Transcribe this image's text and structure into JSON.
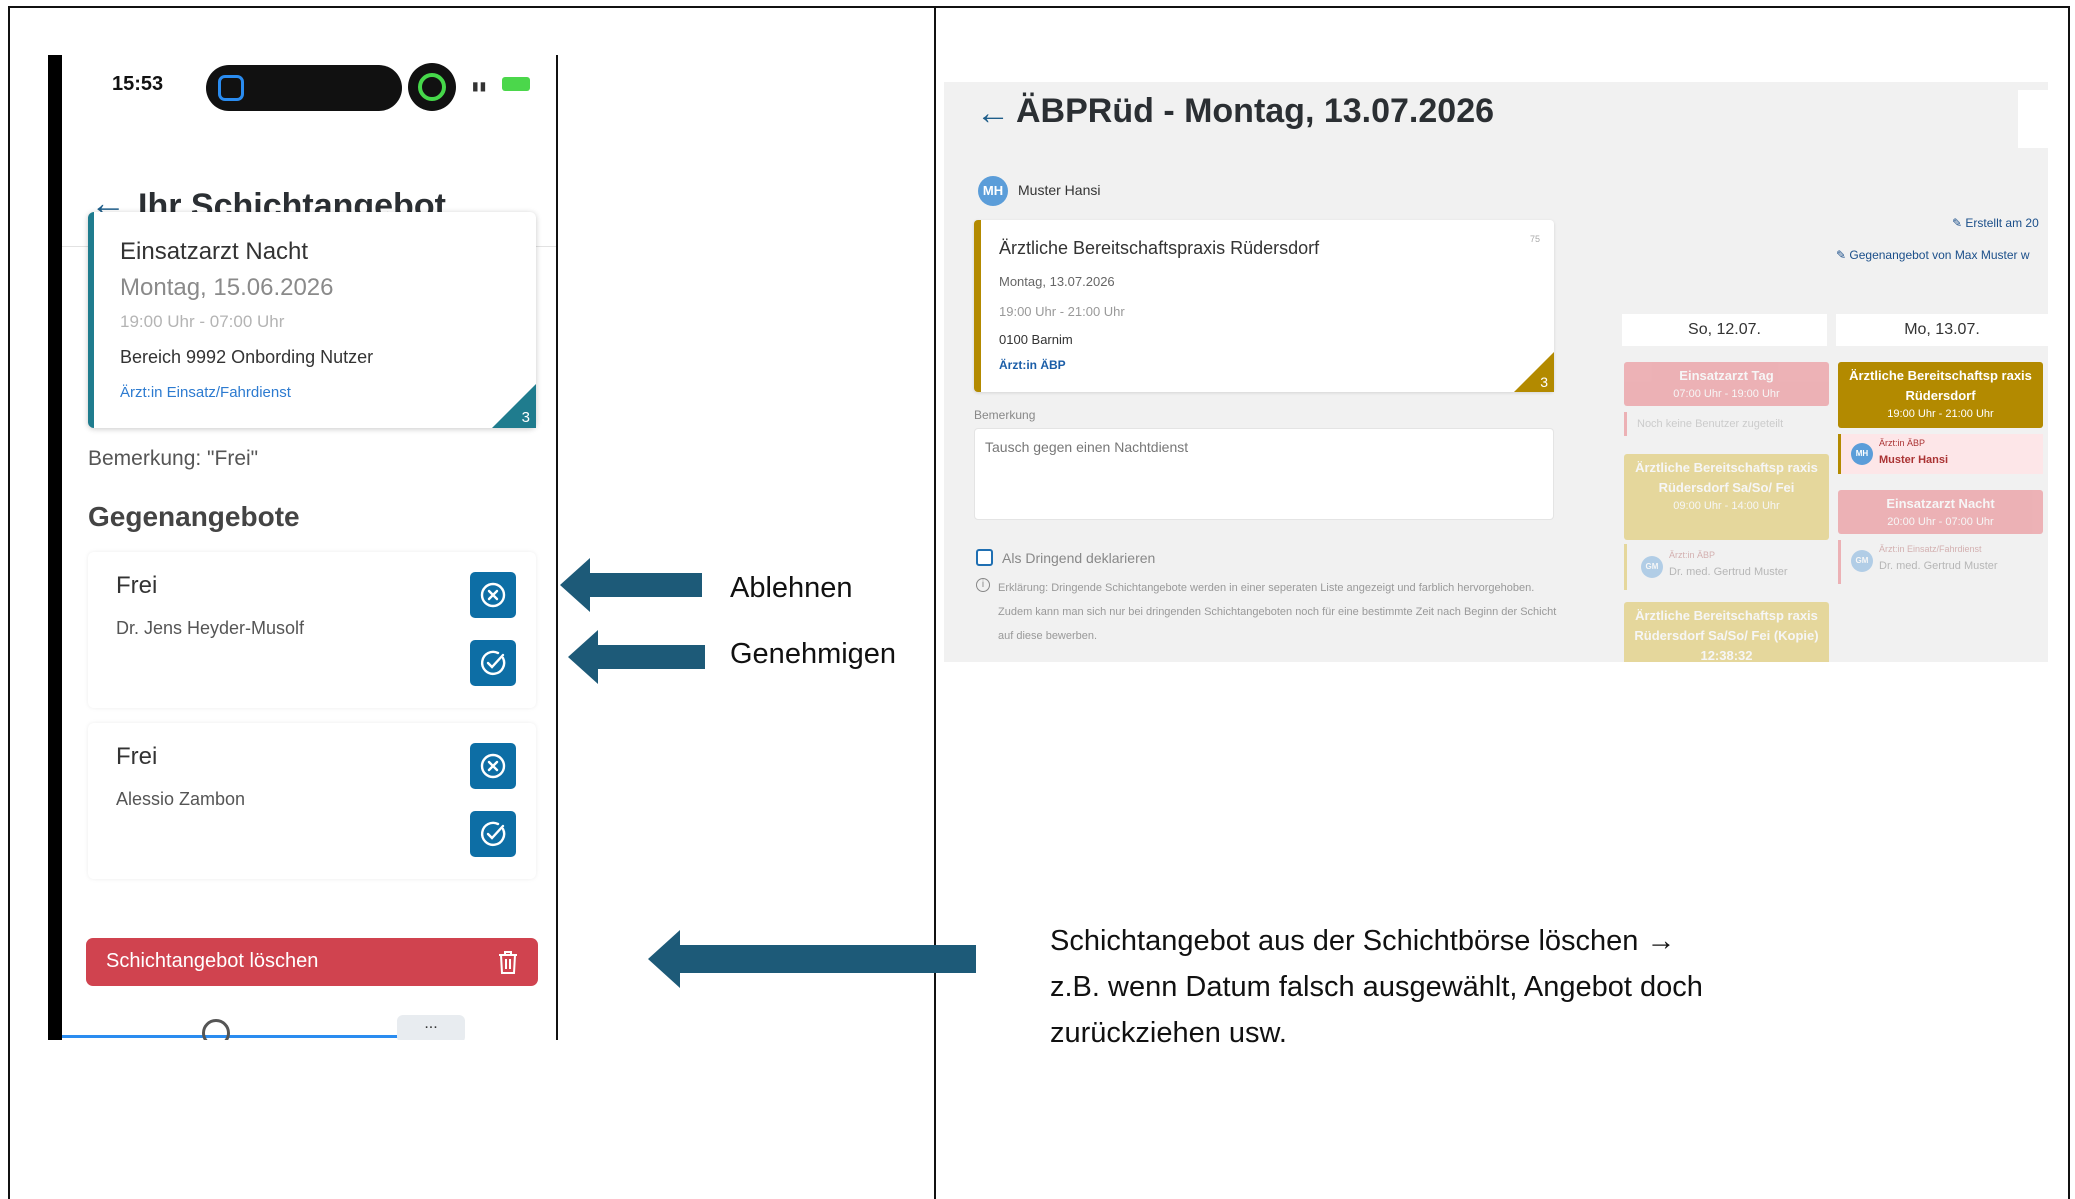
{
  "phone": {
    "status": {
      "time": "15:53"
    },
    "header": {
      "title": "Ihr Schichtangebot"
    },
    "offer": {
      "title": "Einsatzarzt Nacht",
      "date": "Montag, 15.06.2026",
      "time": "19:00 Uhr - 07:00 Uhr",
      "area": "Bereich 9992 Onbording Nutzer",
      "role": "Ärzt:in Einsatz/Fahrdienst",
      "count": "3"
    },
    "remark": "Bemerkung: \"Frei\"",
    "counteroffers_title": "Gegenangebote",
    "counteroffers": [
      {
        "title": "Frei",
        "name": "Dr. Jens Heyder-Musolf"
      },
      {
        "title": "Frei",
        "name": "Alessio Zambon"
      }
    ],
    "delete_label": "Schichtangebot löschen",
    "more_label": "..."
  },
  "annotations": {
    "reject": "Ablehnen",
    "approve": "Genehmigen",
    "delete_line1": "Schichtangebot aus der Schichtbörse löschen →",
    "delete_line2": "z.B. wenn Datum falsch ausgewählt, Angebot doch",
    "delete_line3": "zurückziehen usw.",
    "arrow_color": "#1d5a78"
  },
  "desktop": {
    "title": "ÄBPRüd - Montag, 13.07.2026",
    "user_initials": "MH",
    "user_name": "Muster Hansi",
    "card": {
      "title": "Ärztliche Bereitschaftspraxis Rüdersdorf",
      "number": "75",
      "date": "Montag, 13.07.2026",
      "time": "19:00 Uhr - 21:00 Uhr",
      "area": "0100 Barnim",
      "role": "Ärzt:in ÄBP",
      "count": "3"
    },
    "remark_label": "Bemerkung",
    "remark_value": "Tausch gegen einen Nachtdienst",
    "urgent_label": "Als Dringend deklarieren",
    "info_text": "Erklärung: Dringende Schichtangebote werden in einer seperaten Liste angezeigt und farblich hervorgehoben. Zudem kann man sich nur bei dringenden Schichtangeboten noch für eine bestimmte Zeit nach Beginn der Schicht auf diese bewerben.",
    "created_link": "Erstellt am 20",
    "counter_link": "Gegenangebot von Max Muster w",
    "calendar": {
      "col1_head": "So, 12.07.",
      "col2_head": "Mo, 13.07.",
      "col1": {
        "ev1_title": "Einsatzarzt Tag",
        "ev1_time": "07:00 Uhr - 19:00 Uhr",
        "ev1_note": "Noch keine Benutzer zugeteilt",
        "ev2_title": "Ärztliche Bereitschaftsp raxis Rüdersdorf Sa/So/ Fei",
        "ev2_time": "09:00 Uhr - 14:00 Uhr",
        "ev2_role": "Ärzt:in ÄBP",
        "ev2_user": "Dr. med. Gertrud Muster",
        "ev2_initials": "GM",
        "ev3_title": "Ärztliche Bereitschaftsp raxis Rüdersdorf Sa/So/ Fei (Kopie) 12:38:32"
      },
      "col2": {
        "ev1_title": "Ärztliche Bereitschaftsp raxis Rüdersdorf",
        "ev1_time": "19:00 Uhr - 21:00 Uhr",
        "ev1_role": "Ärzt:in ÄBP",
        "ev1_user": "Muster Hansi",
        "ev1_initials": "MH",
        "ev2_title": "Einsatzarzt Nacht",
        "ev2_time": "20:00 Uhr - 07:00 Uhr",
        "ev2_role": "Ärzt:in Einsatz/Fahrdienst",
        "ev2_user": "Dr. med. Gertrud Muster",
        "ev2_initials": "GM"
      }
    }
  }
}
